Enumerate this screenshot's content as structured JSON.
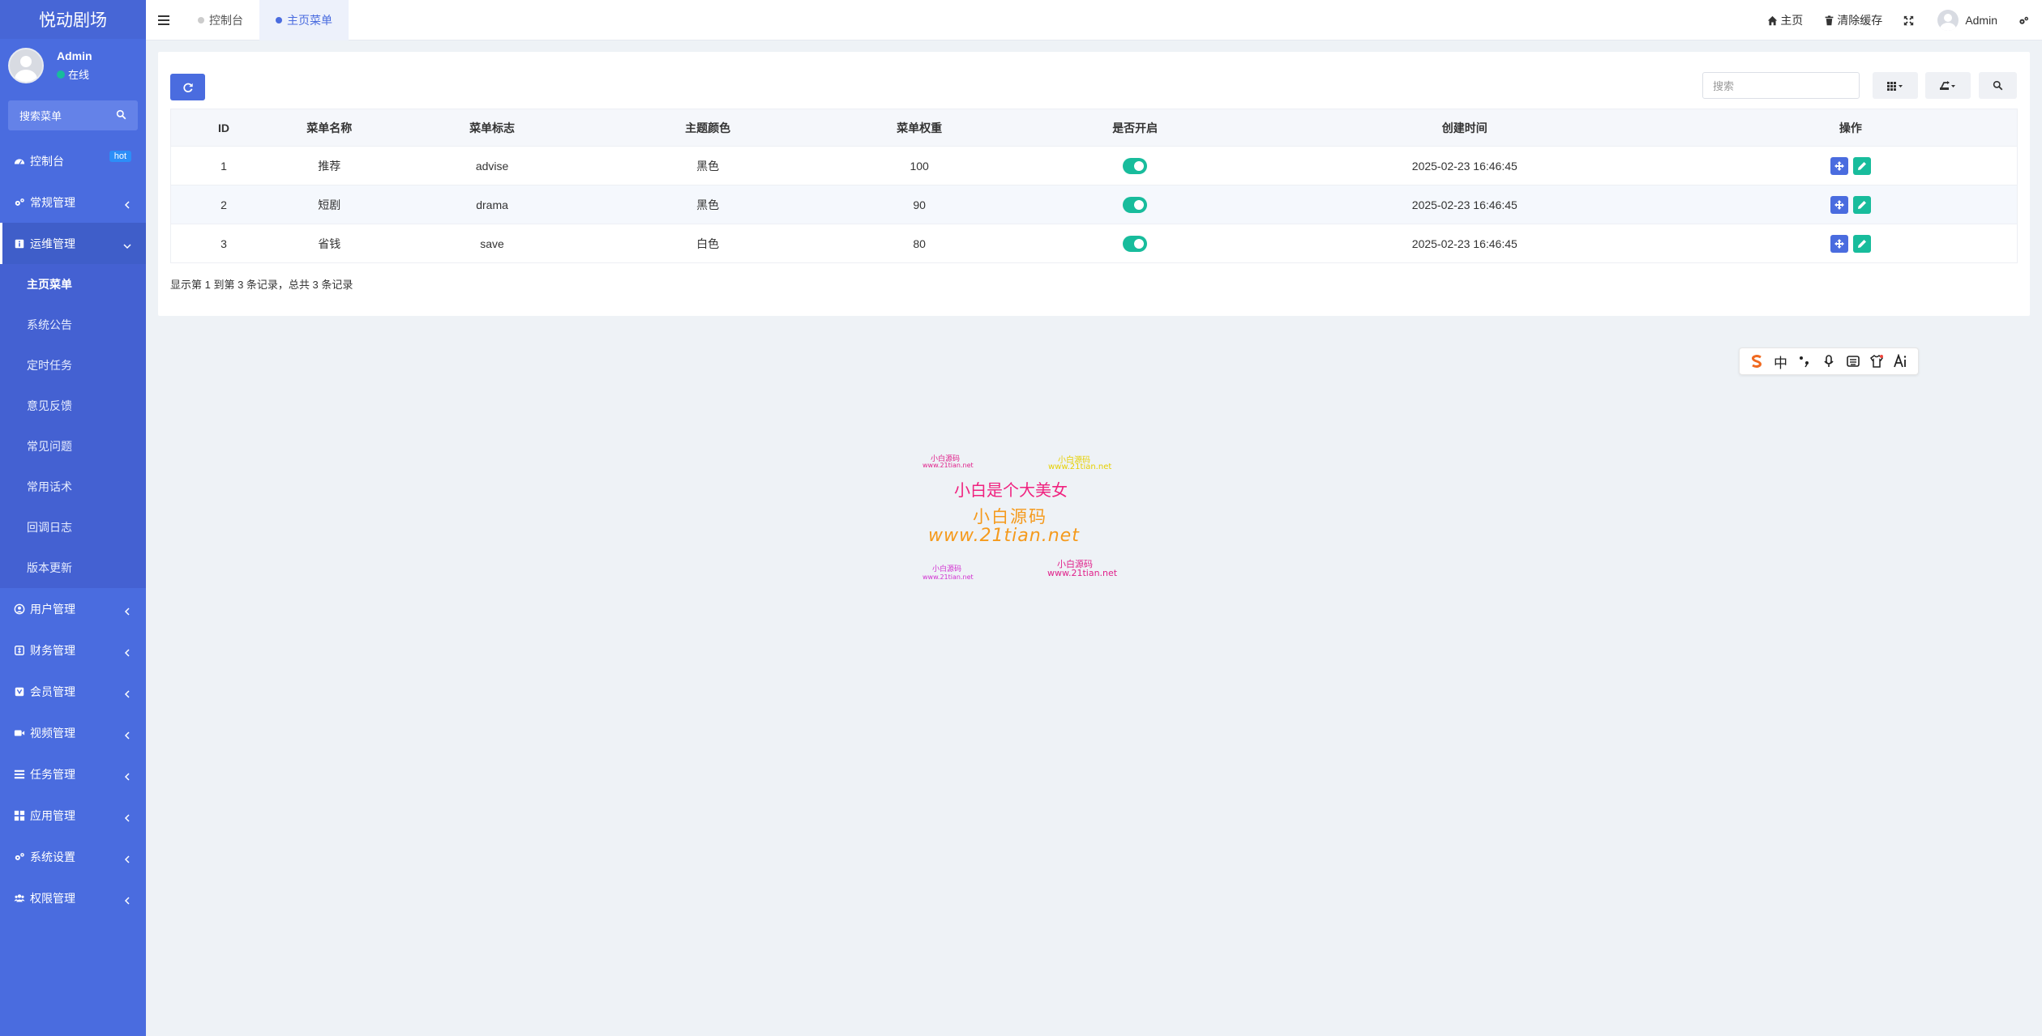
{
  "app": {
    "brand": "悦动剧场"
  },
  "user": {
    "name": "Admin",
    "status": "在线"
  },
  "sidebar": {
    "search_placeholder": "搜索菜单",
    "hot_badge": "hot",
    "items": [
      {
        "label": "控制台",
        "icon": "dashboard-icon"
      },
      {
        "label": "常规管理",
        "icon": "cogs-icon"
      },
      {
        "label": "运维管理",
        "icon": "info-icon",
        "open": true
      },
      {
        "label": "用户管理",
        "icon": "user-circle-icon"
      },
      {
        "label": "财务管理",
        "icon": "finance-icon"
      },
      {
        "label": "会员管理",
        "icon": "member-icon"
      },
      {
        "label": "视频管理",
        "icon": "video-icon"
      },
      {
        "label": "任务管理",
        "icon": "list-icon"
      },
      {
        "label": "应用管理",
        "icon": "apps-icon"
      },
      {
        "label": "系统设置",
        "icon": "cogs-icon"
      },
      {
        "label": "权限管理",
        "icon": "group-icon"
      }
    ],
    "submenu": [
      "主页菜单",
      "系统公告",
      "定时任务",
      "意见反馈",
      "常见问题",
      "常用话术",
      "回调日志",
      "版本更新"
    ]
  },
  "topbar": {
    "tabs": [
      {
        "label": "控制台"
      },
      {
        "label": "主页菜单",
        "active": true
      }
    ],
    "home": "主页",
    "clear_cache": "清除缓存",
    "admin": "Admin"
  },
  "toolbar": {
    "search_placeholder": "搜索"
  },
  "table": {
    "columns": [
      "ID",
      "菜单名称",
      "菜单标志",
      "主题颜色",
      "菜单权重",
      "是否开启",
      "创建时间",
      "操作"
    ],
    "rows": [
      {
        "id": "1",
        "name": "推荐",
        "flag": "advise",
        "color": "黑色",
        "weight": "100",
        "enabled": true,
        "created": "2025-02-23 16:46:45"
      },
      {
        "id": "2",
        "name": "短剧",
        "flag": "drama",
        "color": "黑色",
        "weight": "90",
        "enabled": true,
        "created": "2025-02-23 16:46:45"
      },
      {
        "id": "3",
        "name": "省钱",
        "flag": "save",
        "color": "白色",
        "weight": "80",
        "enabled": true,
        "created": "2025-02-23 16:46:45"
      }
    ],
    "footer": "显示第 1 到第 3 条记录，总共 3 条记录"
  },
  "ime": {
    "lang": "中"
  },
  "watermark": {
    "line1": "小白是个大美女",
    "line2": "小白源码",
    "line3": "www.21tian.net",
    "small_a": "小白源码",
    "small_a_url": "www.21tian.net",
    "small_b": "小白源码",
    "small_b_url": "www.21tian.net",
    "small_c": "小白源码",
    "small_c_url": "www.21tian.net",
    "small_d": "小白源码",
    "small_d_url": "www.21tian.net"
  },
  "colors": {
    "primary": "#4a6cdf",
    "success": "#18bc9c",
    "sidebar_bg": "#4a6cdf"
  }
}
